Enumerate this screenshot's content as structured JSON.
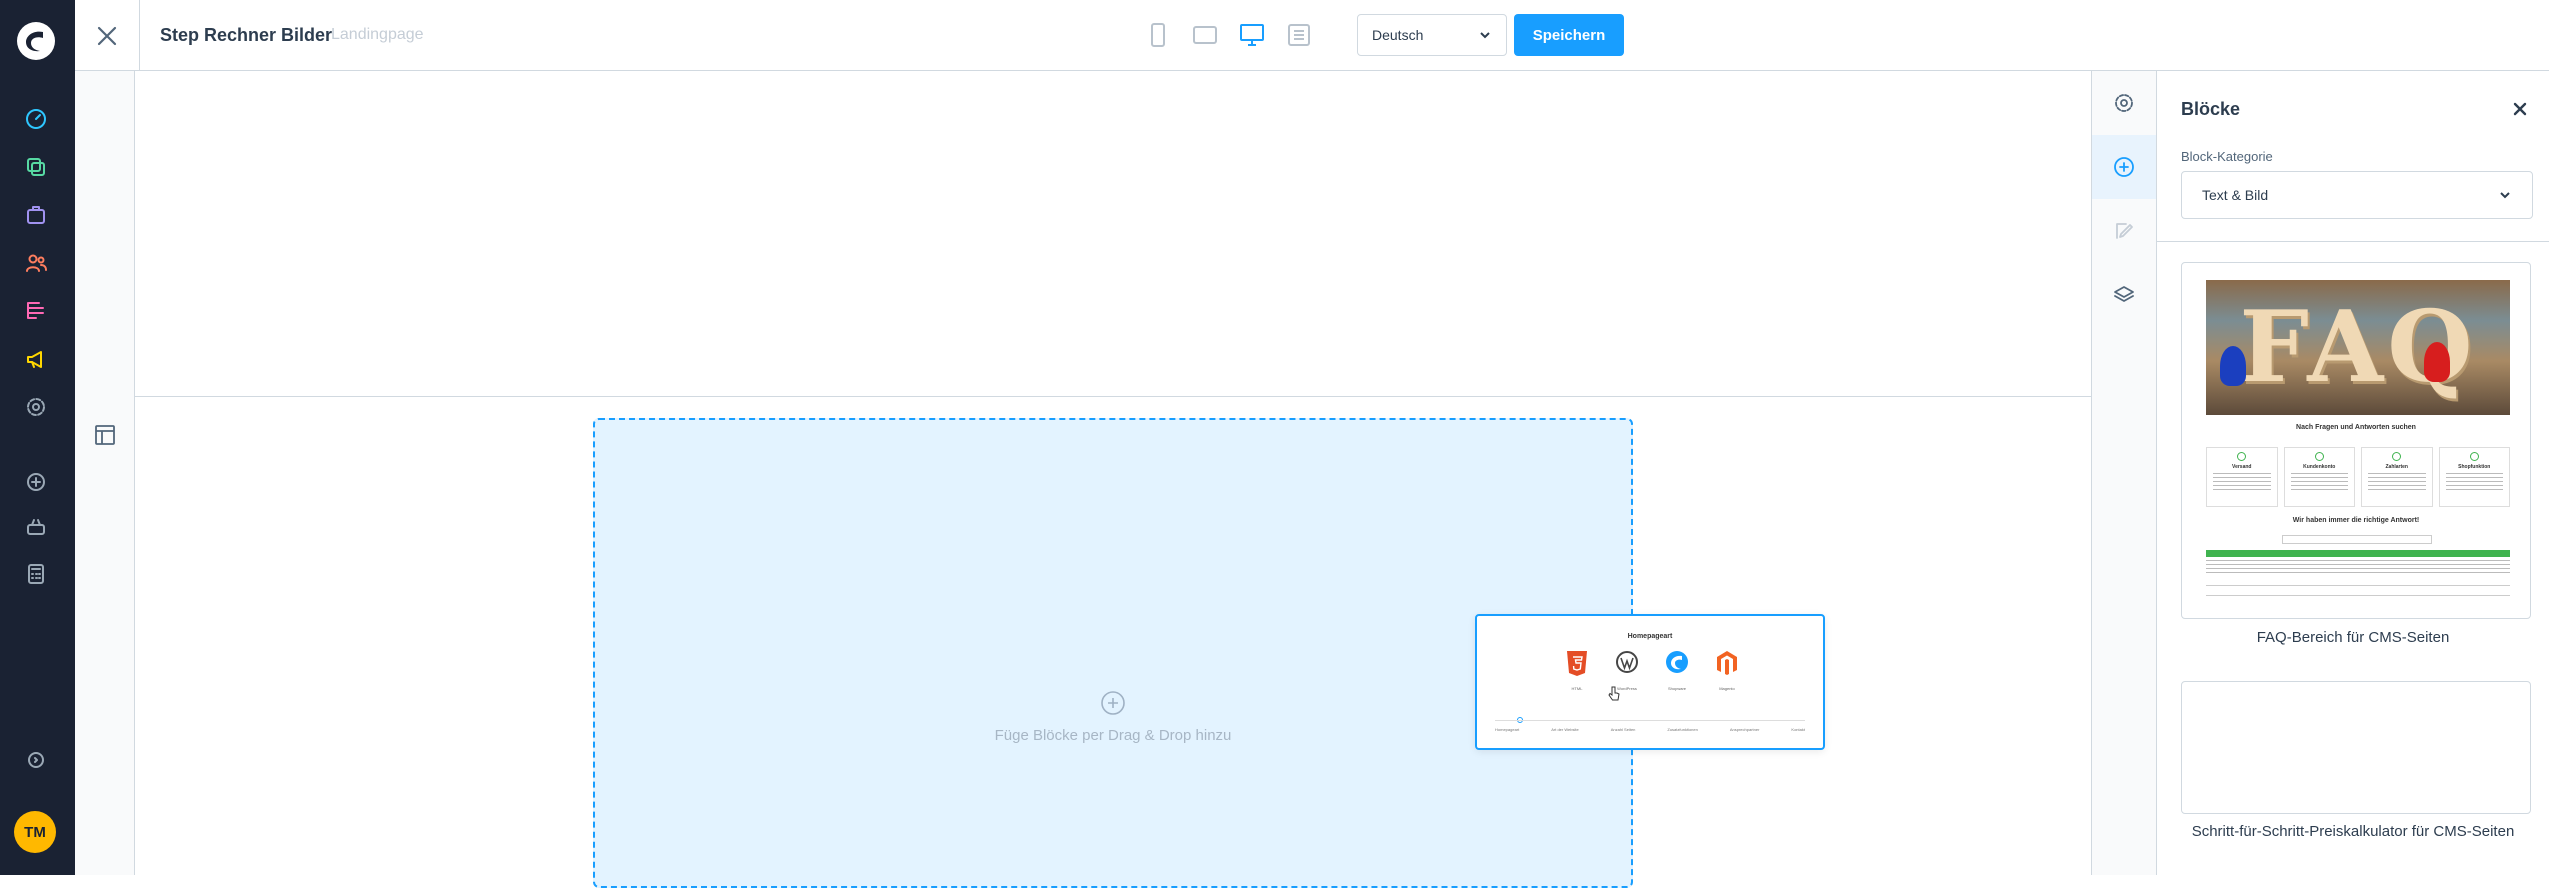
{
  "admin_nav": {
    "logo": "shopware-logo",
    "items": [
      {
        "name": "dashboard-icon",
        "color": "#2ec7ff"
      },
      {
        "name": "catalog-icon",
        "color": "#57d9a3"
      },
      {
        "name": "orders-icon",
        "color": "#a092f0"
      },
      {
        "name": "customers-icon",
        "color": "#ff7e5f"
      },
      {
        "name": "content-icon",
        "color": "#ff68b4"
      },
      {
        "name": "marketing-icon",
        "color": "#ffd700"
      },
      {
        "name": "settings-icon",
        "color": "#9aa8b5"
      },
      {
        "name": "add-extension-icon",
        "color": "#9aa8b5"
      },
      {
        "name": "store-icon",
        "color": "#9aa8b5"
      },
      {
        "name": "calculator-icon",
        "color": "#9aa8b5"
      },
      {
        "name": "info-icon",
        "color": "#9aa8b5"
      }
    ],
    "avatar_initials": "TM"
  },
  "topbar": {
    "page_title": "Step Rechner Bilder",
    "page_type": "Landingpage",
    "viewports": [
      "mobile",
      "tablet",
      "desktop",
      "list"
    ],
    "active_viewport": "desktop",
    "language": "Deutsch",
    "save_label": "Speichern"
  },
  "stage": {
    "dropzone_text": "Füge Blöcke per Drag & Drop hinzu",
    "drag_preview": {
      "title": "Homepageart",
      "logos": [
        {
          "name": "html5-icon",
          "label": "HTML"
        },
        {
          "name": "wordpress-icon",
          "label": "WordPress"
        },
        {
          "name": "shopware-icon",
          "label": "Shopware"
        },
        {
          "name": "magento-icon",
          "label": "Magento"
        }
      ],
      "steps": [
        "Homepageart",
        "Art der Website",
        "Anzahl Seiten",
        "Zusatzfunktionen",
        "Ansprechpartner",
        "Kontakt"
      ]
    }
  },
  "sidebar": {
    "title": "Blöcke",
    "category_label": "Block-Kategorie",
    "category_value": "Text & Bild",
    "blocks": [
      {
        "label": "FAQ-Bereich für CMS-Seiten",
        "preview": {
          "image_text": "FAQ",
          "heading": "Nach Fragen und Antworten suchen",
          "columns": [
            "Versand",
            "Kundenkonto",
            "Zahlarten",
            "Shopfunktion"
          ],
          "subheading": "Wir haben immer die richtige Antwort!"
        }
      },
      {
        "label": "Schritt-für-Schritt-Preiskalkulator für CMS-Seiten"
      }
    ]
  }
}
